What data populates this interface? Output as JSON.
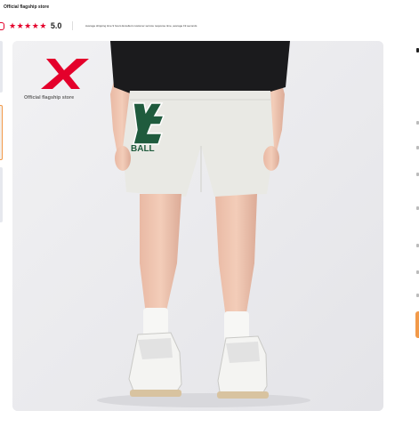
{
  "store": {
    "title": "Official flagship store",
    "rating": "5.0",
    "star_count": 5,
    "service_text": "Average shipping time 9 hours Excellent customer service response time, average 19 seconds"
  },
  "gallery": {
    "logo_caption": "Official flagship store",
    "selected_thumbnail": 2,
    "thumbnail_count": 3
  },
  "colors": {
    "brand": "#e4002b",
    "accent": "#f29a4a",
    "shorts_print": "#1f5b3d"
  }
}
